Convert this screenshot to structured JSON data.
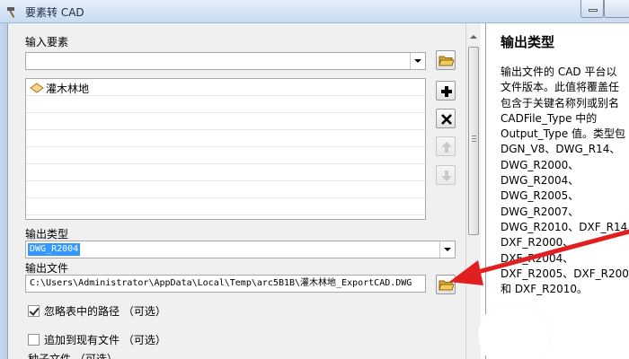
{
  "window": {
    "title": "要素转 CAD",
    "minimize_label": "minimize",
    "maximize_label": "maximize"
  },
  "form": {
    "input_features_label": "输入要素",
    "input_features_value": "",
    "feature_list": [
      {
        "label": "灌木林地"
      }
    ],
    "output_type_label": "输出类型",
    "output_type_value": "DWG_R2004",
    "output_file_label": "输出文件",
    "output_file_value": "C:\\Users\\Administrator\\AppData\\Local\\Temp\\arc5B1B\\灌木林地_ExportCAD.DWG",
    "ignore_paths_label": "忽略表中的路径 （可选）",
    "ignore_paths_checked": true,
    "append_label": "追加到现有文件 （可选）",
    "append_checked": false,
    "seed_file_label": "种子文件 （可选）"
  },
  "side_buttons": {
    "add": "add-icon",
    "remove": "remove-icon",
    "up": "arrow-up-icon",
    "down": "arrow-down-icon"
  },
  "help": {
    "title": "输出类型",
    "lines": [
      "输出文件的 CAD 平台以",
      "文件版本。此值将覆盖任",
      "包含于关键名称列或别名",
      "CADFile_Type 中的",
      "Output_Type 值。类型包",
      "DGN_V8、DWG_R14、",
      "DWG_R2000、",
      "DWG_R2004、",
      "DWG_R2005、",
      "DWG_R2007、",
      "DWG_R2010、DXF_R14",
      "DXF_R2000、",
      "DXF_R2004、",
      "DXF_R2005、DXF_R200",
      "和 DXF_R2010。"
    ]
  },
  "colors": {
    "selection": "#3399ff",
    "annotation_arrow": "#e02020",
    "panel_bg": "#f0f0f0"
  }
}
